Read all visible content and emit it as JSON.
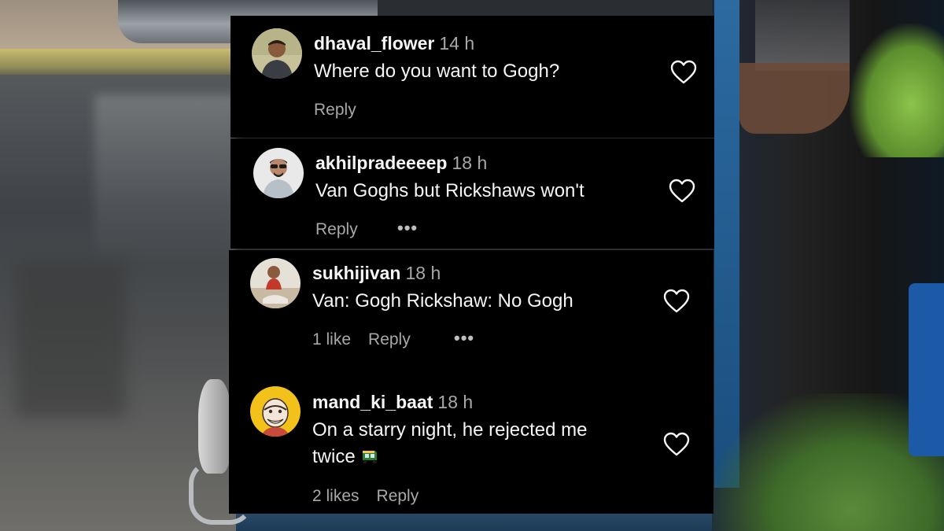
{
  "comments": [
    {
      "username": "dhaval_flower",
      "time": "14 h",
      "text": "Where do you want to Gogh?",
      "likes": "",
      "reply_label": "Reply",
      "has_more": false
    },
    {
      "username": "akhilpradeeeep",
      "time": "18 h",
      "text": "Van Goghs but Rickshaws won't",
      "likes": "",
      "reply_label": "Reply",
      "has_more": true,
      "more_label": "•••"
    },
    {
      "username": "sukhijivan",
      "time": "18 h",
      "text": "Van: Gogh Rickshaw: No Gogh",
      "likes": "1 like",
      "reply_label": "Reply",
      "has_more": true,
      "more_label": "•••"
    },
    {
      "username": "mand_ki_baat",
      "time": "18 h",
      "text_line1": "On a starry night, he rejected me",
      "text_line2": "twice",
      "emoji_icon": "auto-rickshaw-icon",
      "likes": "2 likes",
      "reply_label": "Reply",
      "has_more": false
    }
  ],
  "colors": {
    "panel_bg": "#000000",
    "text_primary": "#f5f5f5",
    "text_secondary": "#a8a8a8",
    "heart_stroke": "#f5f5f5"
  },
  "icons": {
    "like": "heart-outline-icon",
    "more": "more-options-icon"
  }
}
